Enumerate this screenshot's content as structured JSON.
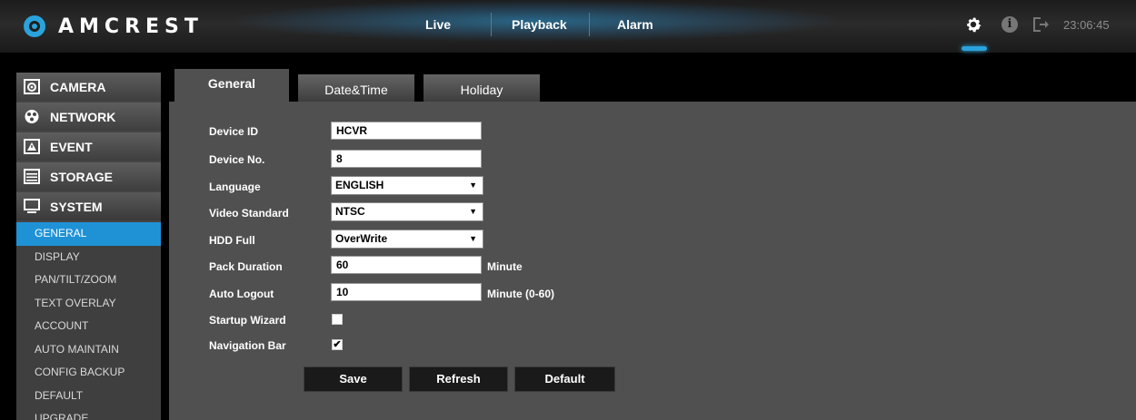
{
  "brand": {
    "logo_text": "AMCREST",
    "accent": "#2aa3dc"
  },
  "topnav": {
    "live": "Live",
    "playback": "Playback",
    "alarm": "Alarm"
  },
  "topright": {
    "time": "23:06:45",
    "icons": [
      "gear-icon",
      "info-icon",
      "logout-icon"
    ]
  },
  "sidebar": {
    "sections": [
      {
        "label": "CAMERA",
        "icon": "camera-icon"
      },
      {
        "label": "NETWORK",
        "icon": "network-icon"
      },
      {
        "label": "EVENT",
        "icon": "event-icon"
      },
      {
        "label": "STORAGE",
        "icon": "storage-icon"
      },
      {
        "label": "SYSTEM",
        "icon": "monitor-icon"
      }
    ],
    "system_items": [
      "GENERAL",
      "DISPLAY",
      "PAN/TILT/ZOOM",
      "TEXT OVERLAY",
      "ACCOUNT",
      "AUTO MAINTAIN",
      "CONFIG BACKUP",
      "DEFAULT",
      "UPGRADE"
    ],
    "active_item": "GENERAL"
  },
  "tabs": {
    "general": "General",
    "datetime": "Date&Time",
    "holiday": "Holiday",
    "active": "General"
  },
  "form": {
    "device_id": {
      "label": "Device ID",
      "value": "HCVR"
    },
    "device_no": {
      "label": "Device No.",
      "value": "8"
    },
    "language": {
      "label": "Language",
      "value": "ENGLISH"
    },
    "video_standard": {
      "label": "Video Standard",
      "value": "NTSC"
    },
    "hdd_full": {
      "label": "HDD Full",
      "value": "OverWrite"
    },
    "pack_duration": {
      "label": "Pack Duration",
      "value": "60",
      "unit": "Minute"
    },
    "auto_logout": {
      "label": "Auto Logout",
      "value": "10",
      "unit": "Minute (0-60)"
    },
    "startup_wizard": {
      "label": "Startup Wizard",
      "checked": false
    },
    "navigation_bar": {
      "label": "Navigation Bar",
      "checked": true,
      "mark": "✔"
    }
  },
  "buttons": {
    "save": "Save",
    "refresh": "Refresh",
    "default": "Default"
  }
}
